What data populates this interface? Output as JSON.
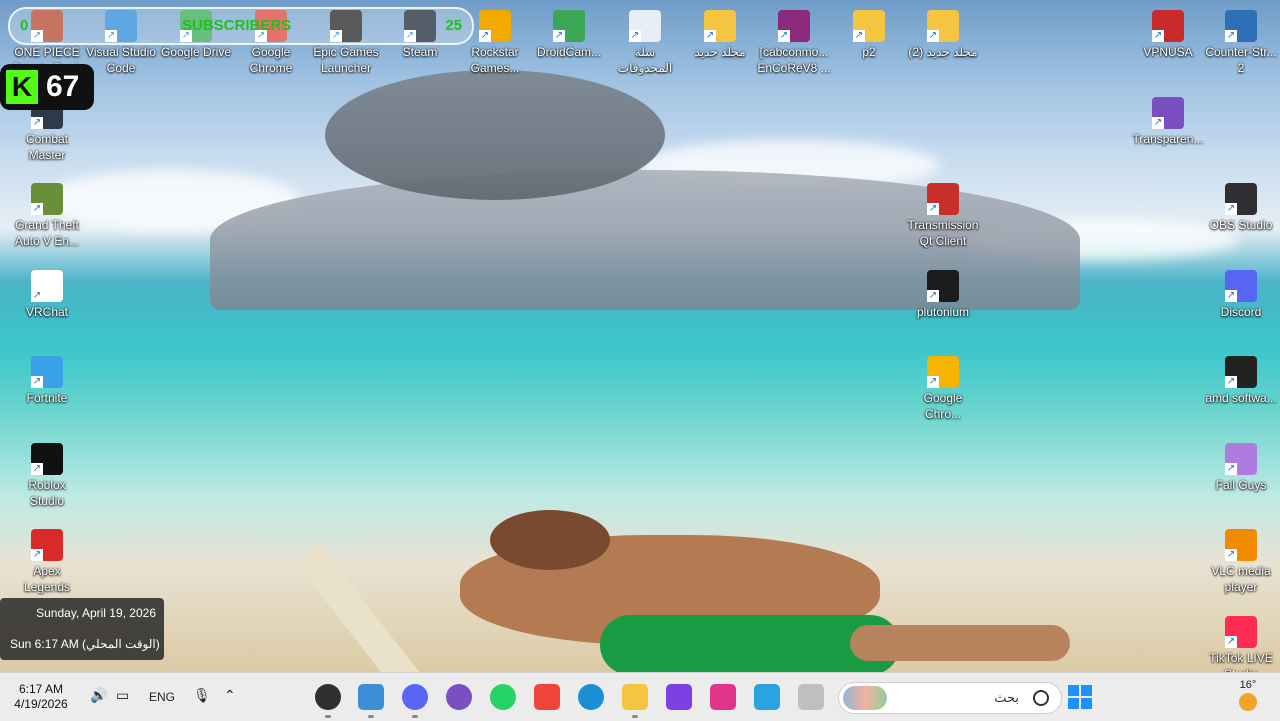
{
  "overlay": {
    "subscribers_left": "0",
    "subscribers_label": "SUBSCRIBERS",
    "subscribers_right": "25",
    "kick_letter": "K",
    "kick_count": "67"
  },
  "desktop_icons": [
    {
      "label": "ONE PIECE\nBounty Rush",
      "color": "#b3452d"
    },
    {
      "label": "Visual Studio\nCode",
      "color": "#2a8ad8"
    },
    {
      "label": "Google Drive",
      "color": "#34a853"
    },
    {
      "label": "Google\nChrome",
      "color": "#db4437"
    },
    {
      "label": "Epic Games\nLauncher",
      "color": "#222222"
    },
    {
      "label": "Steam",
      "color": "#1b2838"
    },
    {
      "label": "Rockstar\nGames...",
      "color": "#f2a900"
    },
    {
      "label": "DroidCam...",
      "color": "#3aa757"
    },
    {
      "label": "سلة\nالمحذوفات",
      "color": "#e8eef5"
    },
    {
      "label": "مجلد جديد",
      "color": "#f5c542"
    },
    {
      "label": "[cabconmo...\nEnCoReV8 ...",
      "color": "#8b2a7a"
    },
    {
      "label": "p2",
      "color": "#f5c542"
    },
    {
      "label": "مجلد جديد (2)",
      "color": "#f5c542"
    },
    {
      "label": "VPNUSA",
      "color": "#c92a2a"
    },
    {
      "label": "Counter-Str...\n2",
      "color": "#2f6fb5"
    },
    {
      "label": "Combat\nMaster",
      "color": "#2d3a4a"
    },
    {
      "label": "Transparen...",
      "color": "#7a4fc2"
    },
    {
      "label": "Grand Theft\nAuto V En...",
      "color": "#6a8f3a"
    },
    {
      "label": "Transmission\nQt Client",
      "color": "#c9302c"
    },
    {
      "label": "OBS Studio",
      "color": "#302e31"
    },
    {
      "label": "VRChat",
      "color": "#ffffff"
    },
    {
      "label": "plutonium",
      "color": "#1c1c1c"
    },
    {
      "label": "Discord",
      "color": "#5865f2"
    },
    {
      "label": "Fortnite",
      "color": "#3aa0e8"
    },
    {
      "label": "Google\nChro...",
      "color": "#f4b400"
    },
    {
      "label": "amd softwa...",
      "color": "#222222"
    },
    {
      "label": "Roblox\nStudio",
      "color": "#111111"
    },
    {
      "label": "Fall Guys",
      "color": "#b07be0"
    },
    {
      "label": "Apex\nLegends",
      "color": "#da292a"
    },
    {
      "label": "VLC media\nplayer",
      "color": "#f08a00"
    },
    {
      "label": "TikTok LIVE\nStudio",
      "color": "#fe2c55"
    }
  ],
  "date_popup": {
    "long_date": "Sunday, April 19, 2026",
    "local_time": "Sun 6:17 AM (الوقت المحلي)"
  },
  "taskbar": {
    "time": "6:17 AM",
    "date": "4/19/2026",
    "language": "ENG",
    "search_placeholder": "بحث",
    "weather_temp": "16°",
    "apps": [
      {
        "name": "obs",
        "color": "#302e31"
      },
      {
        "name": "keyboard-app",
        "color": "#3a8fd6"
      },
      {
        "name": "discord",
        "color": "#5865f2"
      },
      {
        "name": "chat-app",
        "color": "#7a4fc2"
      },
      {
        "name": "whatsapp",
        "color": "#25d366"
      },
      {
        "name": "anydesk",
        "color": "#ef443b"
      },
      {
        "name": "edge",
        "color": "#1b8fd6"
      },
      {
        "name": "file-explorer",
        "color": "#f5c542"
      },
      {
        "name": "clipchamp",
        "color": "#7b3fe4"
      },
      {
        "name": "app-hex",
        "color": "#e0338a"
      },
      {
        "name": "telegram",
        "color": "#2aa3e0"
      },
      {
        "name": "task-view",
        "color": "#bfbfbf"
      }
    ]
  }
}
